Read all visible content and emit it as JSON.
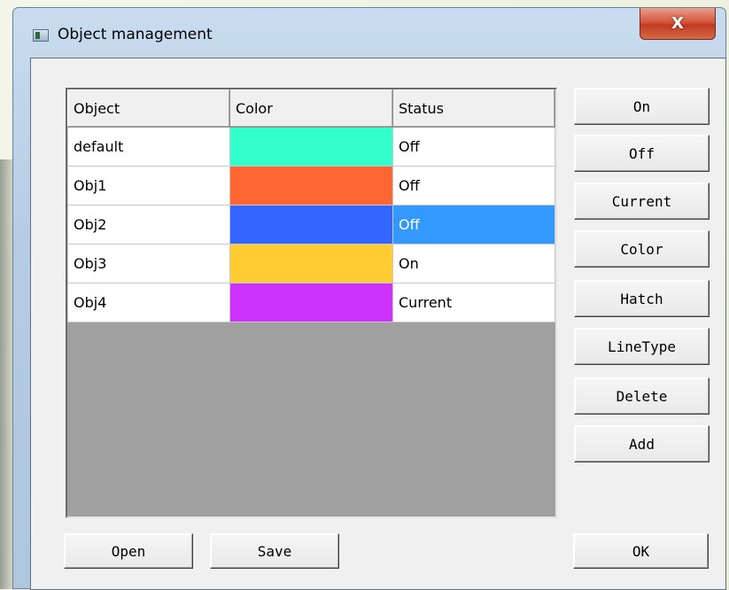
{
  "window": {
    "title": "Object management",
    "close_label": "X"
  },
  "table": {
    "columns": [
      "Object",
      "Color",
      "Status"
    ],
    "rows": [
      {
        "object": "default",
        "color": "#33ffcc",
        "status": "Off"
      },
      {
        "object": "Obj1",
        "color": "#ff6633",
        "status": "Off"
      },
      {
        "object": "Obj2",
        "color": "#3366ff",
        "status": "Off",
        "selected": true
      },
      {
        "object": "Obj3",
        "color": "#ffcc33",
        "status": "On"
      },
      {
        "object": "Obj4",
        "color": "#cc33ff",
        "status": "Current"
      }
    ]
  },
  "side_buttons": [
    "On",
    "Off",
    "Current",
    "Color",
    "Hatch",
    "LineType",
    "Delete",
    "Add"
  ],
  "bottom_buttons": {
    "open": "Open",
    "save": "Save",
    "ok": "OK"
  },
  "colors": {
    "selection": "#3399ff",
    "grid_background": "#a0a0a0",
    "close_button": "#c23a20"
  }
}
